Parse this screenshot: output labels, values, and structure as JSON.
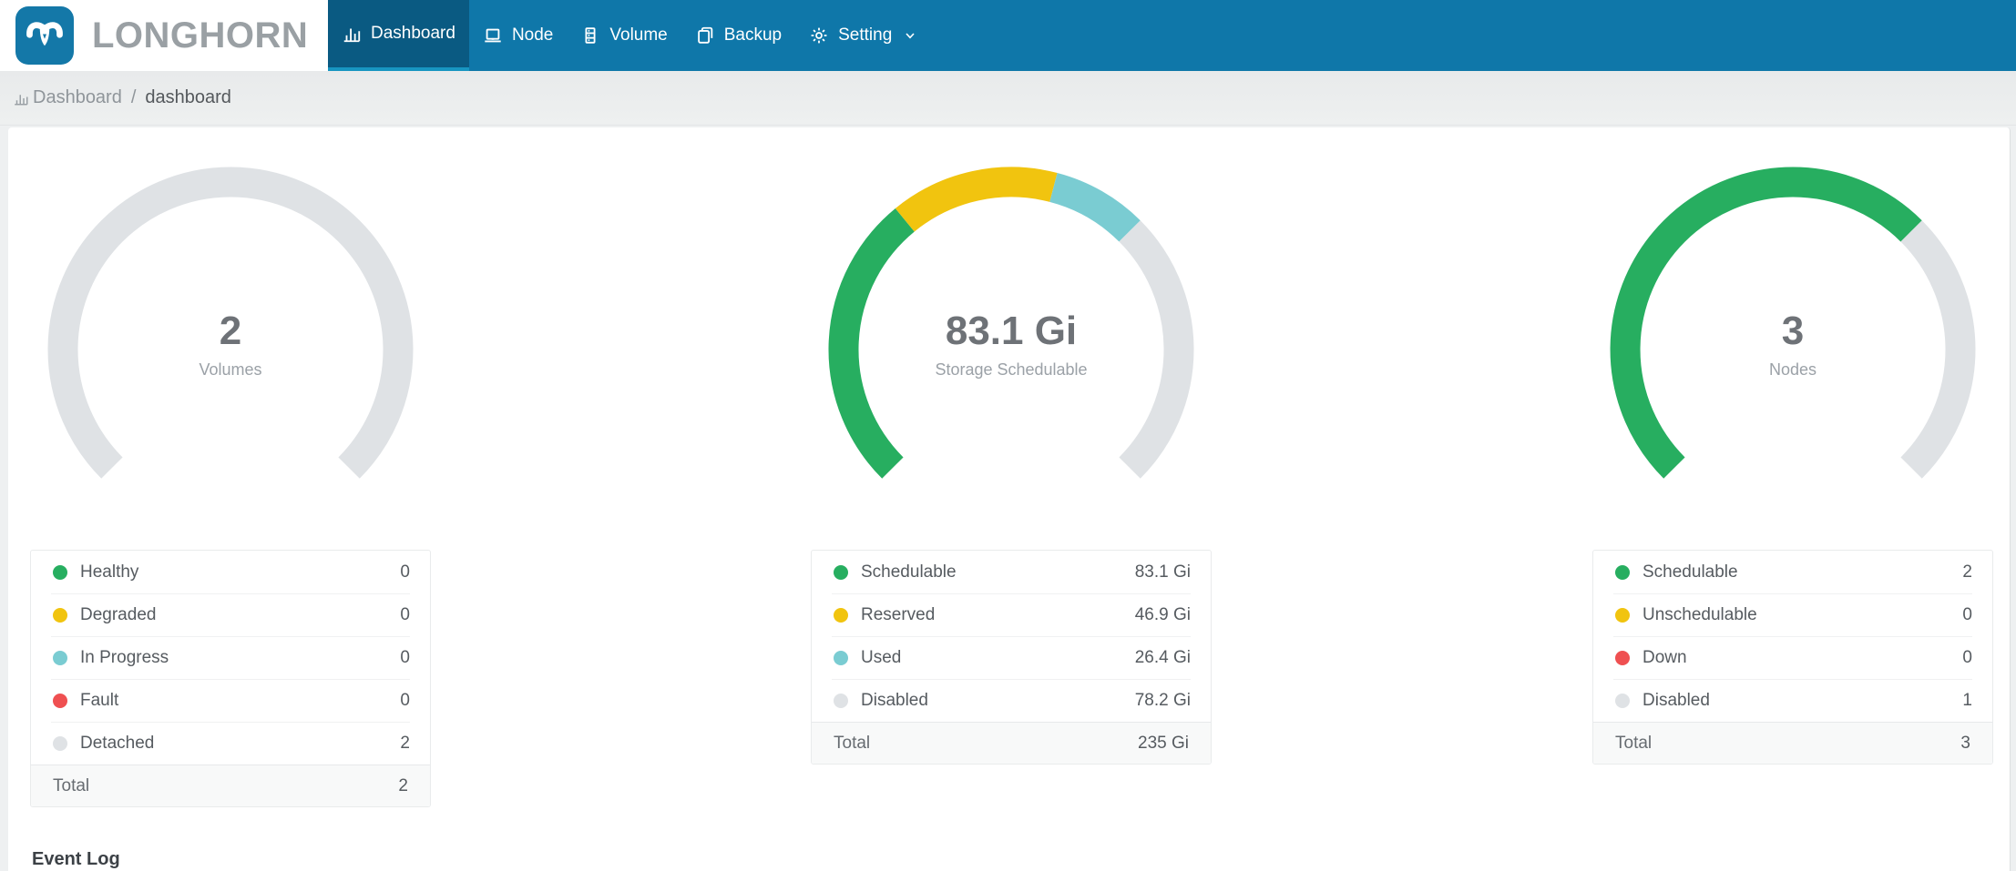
{
  "app": {
    "name": "LONGHORN"
  },
  "navbar": {
    "items": [
      {
        "label": "Dashboard",
        "icon": "bar-chart-icon",
        "active": true
      },
      {
        "label": "Node",
        "icon": "laptop-icon",
        "active": false
      },
      {
        "label": "Volume",
        "icon": "database-icon",
        "active": false
      },
      {
        "label": "Backup",
        "icon": "backup-icon",
        "active": false
      },
      {
        "label": "Setting",
        "icon": "gear-icon",
        "active": false,
        "has_dropdown": true
      }
    ]
  },
  "breadcrumb": {
    "root": "Dashboard",
    "separator": "/",
    "current": "dashboard"
  },
  "colors": {
    "navbar": "#0f77a9",
    "navbar_active": "#0a5a82",
    "navbar_active_border": "#1795c1",
    "green": "#27ae60",
    "yellow": "#f1c40f",
    "cyan": "#7accd2",
    "red": "#ef5051",
    "gray": "#dfe2e5"
  },
  "chart_data": [
    {
      "type": "gauge",
      "title": "Volumes",
      "center_value": "2",
      "center_label": "Volumes",
      "start_angle_degrees": -135,
      "arc_span_degrees": 270,
      "total": 2,
      "segments": [
        {
          "name": "Healthy",
          "value": 0,
          "color": "#27ae60"
        },
        {
          "name": "Degraded",
          "value": 0,
          "color": "#f1c40f"
        },
        {
          "name": "In Progress",
          "value": 0,
          "color": "#7accd2"
        },
        {
          "name": "Fault",
          "value": 0,
          "color": "#ef5051"
        },
        {
          "name": "Detached",
          "value": 2,
          "color": "#dfe2e5"
        }
      ]
    },
    {
      "type": "gauge",
      "title": "Storage Schedulable",
      "center_value": "83.1 Gi",
      "center_label": "Storage Schedulable",
      "start_angle_degrees": -135,
      "arc_span_degrees": 270,
      "total": 235,
      "unit": "Gi",
      "segments": [
        {
          "name": "Schedulable",
          "value": 83.1,
          "color": "#27ae60"
        },
        {
          "name": "Reserved",
          "value": 46.9,
          "color": "#f1c40f"
        },
        {
          "name": "Used",
          "value": 26.4,
          "color": "#7accd2"
        },
        {
          "name": "Disabled",
          "value": 78.2,
          "color": "#dfe2e5"
        }
      ]
    },
    {
      "type": "gauge",
      "title": "Nodes",
      "center_value": "3",
      "center_label": "Nodes",
      "start_angle_degrees": -135,
      "arc_span_degrees": 270,
      "total": 3,
      "segments": [
        {
          "name": "Schedulable",
          "value": 2,
          "color": "#27ae60"
        },
        {
          "name": "Unschedulable",
          "value": 0,
          "color": "#f1c40f"
        },
        {
          "name": "Down",
          "value": 0,
          "color": "#ef5051"
        },
        {
          "name": "Disabled",
          "value": 1,
          "color": "#dfe2e5"
        }
      ]
    }
  ],
  "tables": [
    {
      "rows": [
        {
          "label": "Healthy",
          "value": "0",
          "color": "#27ae60"
        },
        {
          "label": "Degraded",
          "value": "0",
          "color": "#f1c40f"
        },
        {
          "label": "In Progress",
          "value": "0",
          "color": "#7accd2"
        },
        {
          "label": "Fault",
          "value": "0",
          "color": "#ef5051"
        },
        {
          "label": "Detached",
          "value": "2",
          "color": "#dfe2e5"
        }
      ],
      "total_label": "Total",
      "total_value": "2"
    },
    {
      "rows": [
        {
          "label": "Schedulable",
          "value": "83.1 Gi",
          "color": "#27ae60"
        },
        {
          "label": "Reserved",
          "value": "46.9 Gi",
          "color": "#f1c40f"
        },
        {
          "label": "Used",
          "value": "26.4 Gi",
          "color": "#7accd2"
        },
        {
          "label": "Disabled",
          "value": "78.2 Gi",
          "color": "#dfe2e5"
        }
      ],
      "total_label": "Total",
      "total_value": "235 Gi"
    },
    {
      "rows": [
        {
          "label": "Schedulable",
          "value": "2",
          "color": "#27ae60"
        },
        {
          "label": "Unschedulable",
          "value": "0",
          "color": "#f1c40f"
        },
        {
          "label": "Down",
          "value": "0",
          "color": "#ef5051"
        },
        {
          "label": "Disabled",
          "value": "1",
          "color": "#dfe2e5"
        }
      ],
      "total_label": "Total",
      "total_value": "3"
    }
  ],
  "event_log": {
    "title": "Event Log"
  }
}
